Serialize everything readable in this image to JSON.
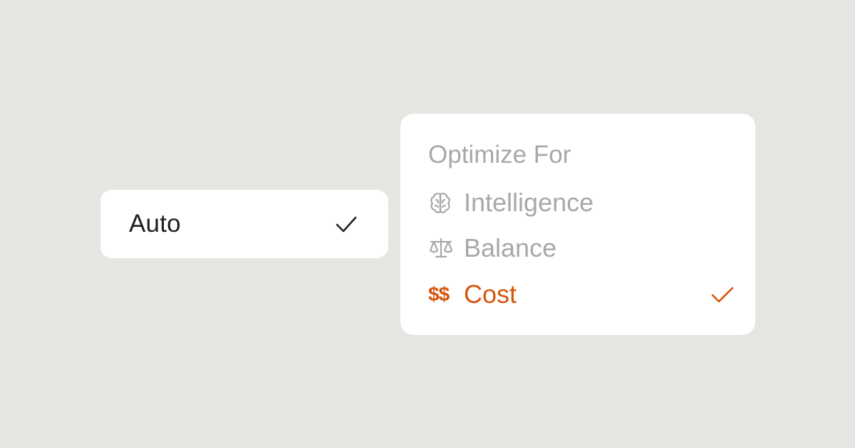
{
  "colors": {
    "background": "#e6e5e1",
    "card": "#ffffff",
    "muted_text": "#a8a8a8",
    "primary_text": "#1f1f1f",
    "accent": "#d9540b"
  },
  "auto_option": {
    "label": "Auto",
    "selected": true,
    "check_icon": "checkmark-icon"
  },
  "optimize_menu": {
    "title": "Optimize For",
    "options": [
      {
        "label": "Intelligence",
        "icon": "brain-icon",
        "selected": false
      },
      {
        "label": "Balance",
        "icon": "scale-icon",
        "selected": false
      },
      {
        "label": "Cost",
        "icon": "dollar-icon",
        "icon_text": "$$",
        "selected": true
      }
    ]
  }
}
